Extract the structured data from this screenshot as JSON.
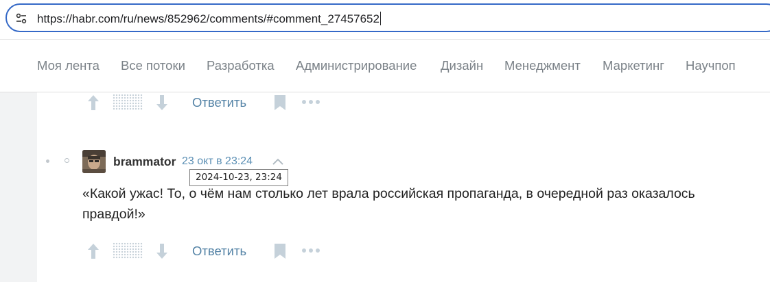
{
  "browser": {
    "url": "https://habr.com/ru/news/852962/comments/#comment_27457652"
  },
  "nav": {
    "items": [
      "Моя лента",
      "Все потоки",
      "Разработка",
      "Администрирование",
      "Дизайн",
      "Менеджмент",
      "Маркетинг",
      "Научпоп"
    ]
  },
  "comment_actions": {
    "reply_label": "Ответить"
  },
  "comment": {
    "author": "brammator",
    "time": "23 окт в 23:24",
    "tooltip": "2024-10-23, 23:24",
    "text": "«Какой ужас! То, о чём нам столько лет врала российская пропаганда, в очередной раз оказалось правдой!»"
  },
  "colors": {
    "link": "#5483a6",
    "accent_border": "#3569c7",
    "nav_text": "#7b8288"
  }
}
